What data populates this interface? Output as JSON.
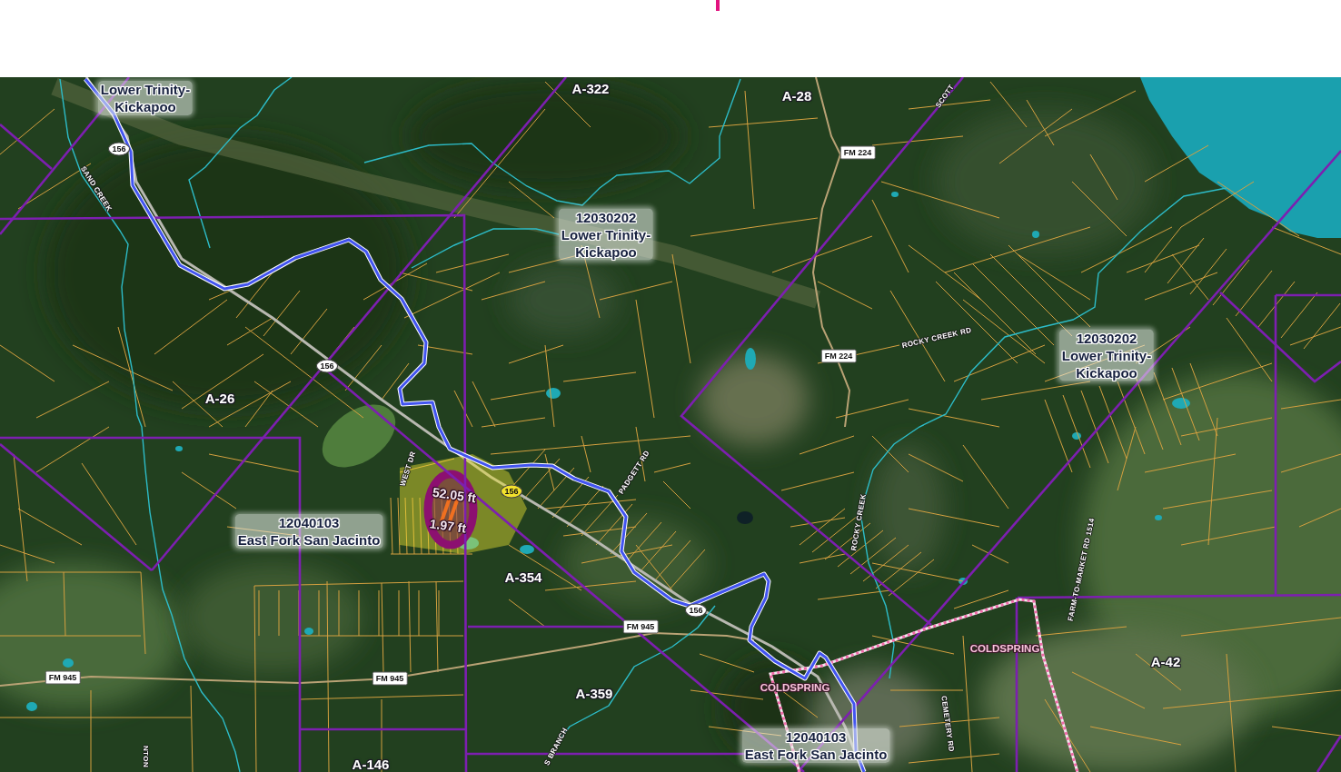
{
  "map": {
    "watershed_labels": [
      {
        "lines": [
          "Lower Trinity-",
          "Kickapoo"
        ]
      },
      {
        "lines": [
          "12030202",
          "Lower Trinity-",
          "Kickapoo"
        ]
      },
      {
        "lines": [
          "12030202",
          "Lower Trinity-",
          "Kickapoo"
        ]
      },
      {
        "lines": [
          "12040103",
          "East Fork San Jacinto"
        ]
      },
      {
        "lines": [
          "12040103",
          "East Fork San Jacinto"
        ]
      }
    ],
    "abstract_labels": [
      "A-322",
      "A-28",
      "A-26",
      "A-354",
      "A-359",
      "A-146",
      "A-42"
    ],
    "road_shields": [
      "FM 224",
      "FM 224",
      "FM 945",
      "FM 945",
      "FM 945"
    ],
    "route_shields": [
      {
        "text": "156",
        "highlighted": false
      },
      {
        "text": "156",
        "highlighted": false
      },
      {
        "text": "156",
        "highlighted": true
      },
      {
        "text": "156",
        "highlighted": false
      }
    ],
    "street_labels": [
      "SAND CREEK",
      "SCOTT",
      "ROCKY CREEK RD",
      "WEST DR",
      "PADGETT RD",
      "ROCKY CREEK",
      "FARM-TO-MARKET RD 1514",
      "CEMETERY RD",
      "S BRANCH",
      "NTON"
    ],
    "place_labels": [
      "COLDSPRING",
      "COLDSPRING"
    ],
    "measurements": [
      "52.05 ft",
      "1.97 ft"
    ]
  }
}
